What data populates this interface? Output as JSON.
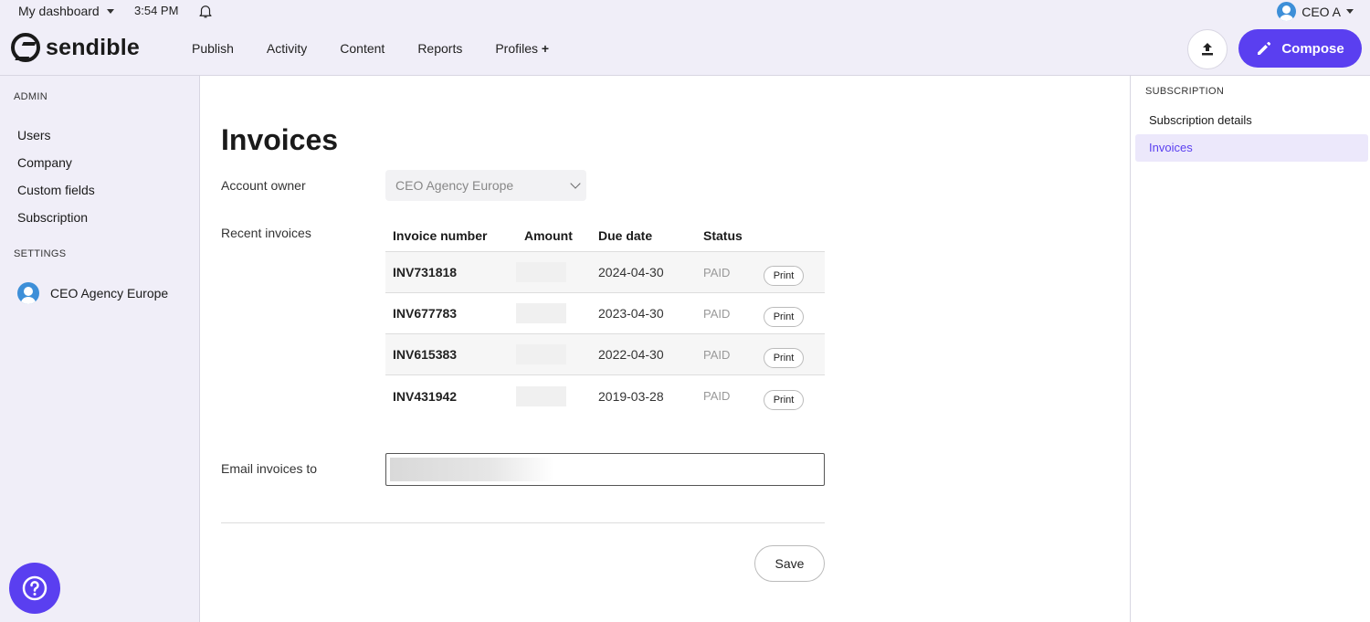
{
  "topbar": {
    "dashboard": "My dashboard",
    "time": "3:54 PM",
    "user": "CEO A"
  },
  "nav": {
    "logo": "sendible",
    "menu": [
      "Publish",
      "Activity",
      "Content",
      "Reports",
      "Profiles"
    ],
    "profiles_plus": "+",
    "compose": "Compose"
  },
  "sidebar": {
    "admin_title": "ADMIN",
    "admin_items": [
      "Users",
      "Company",
      "Custom fields",
      "Subscription"
    ],
    "settings_title": "SETTINGS",
    "profile": "CEO Agency Europe"
  },
  "main": {
    "title": "Invoices",
    "account_owner_label": "Account owner",
    "account_owner_value": "CEO Agency Europe",
    "recent_invoices_label": "Recent invoices",
    "columns": [
      "Invoice number",
      "Amount",
      "Due date",
      "Status"
    ],
    "invoices": [
      {
        "number": "INV731818",
        "due": "2024-04-30",
        "status": "PAID",
        "action": "Print"
      },
      {
        "number": "INV677783",
        "due": "2023-04-30",
        "status": "PAID",
        "action": "Print"
      },
      {
        "number": "INV615383",
        "due": "2022-04-30",
        "status": "PAID",
        "action": "Print"
      },
      {
        "number": "INV431942",
        "due": "2019-03-28",
        "status": "PAID",
        "action": "Print"
      }
    ],
    "email_label": "Email invoices to",
    "save": "Save"
  },
  "right": {
    "title": "SUBSCRIPTION",
    "items": [
      "Subscription details",
      "Invoices"
    ],
    "active": "Invoices"
  },
  "colors": {
    "accent": "#5a3ff0",
    "background": "#f0eef8"
  }
}
